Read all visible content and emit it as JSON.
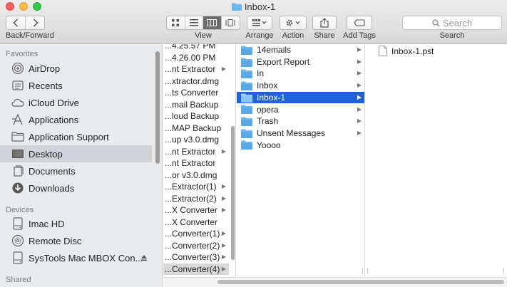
{
  "window": {
    "title": "Inbox-1"
  },
  "toolbar": {
    "nav_label": "Back/Forward",
    "view_label": "View",
    "arrange_label": "Arrange",
    "action_label": "Action",
    "share_label": "Share",
    "tags_label": "Add Tags",
    "search_placeholder": "Search",
    "search_label": "Search"
  },
  "sidebar": {
    "sections": {
      "favorites": "Favorites",
      "devices": "Devices",
      "shared": "Shared"
    },
    "favorites": [
      {
        "label": "AirDrop",
        "icon": "airdrop-icon"
      },
      {
        "label": "Recents",
        "icon": "recents-icon"
      },
      {
        "label": "iCloud Drive",
        "icon": "cloud-icon"
      },
      {
        "label": "Applications",
        "icon": "applications-icon"
      },
      {
        "label": "Application Support",
        "icon": "folder-icon"
      },
      {
        "label": "Desktop",
        "icon": "desktop-icon",
        "selected": true
      },
      {
        "label": "Documents",
        "icon": "documents-icon"
      },
      {
        "label": "Downloads",
        "icon": "downloads-icon"
      }
    ],
    "devices": [
      {
        "label": "Imac HD",
        "icon": "hard-drive-icon"
      },
      {
        "label": "Remote Disc",
        "icon": "disc-icon"
      },
      {
        "label": "SysTools Mac MBOX Con...",
        "icon": "drive-icon"
      }
    ]
  },
  "column1": {
    "items": [
      {
        "label": "...4.25.57 PM",
        "arrow": false
      },
      {
        "label": "...4.26.00 PM",
        "arrow": false
      },
      {
        "label": "...nt Extractor",
        "arrow": true
      },
      {
        "label": "...xtractor.dmg",
        "arrow": false
      },
      {
        "label": "...ts Converter",
        "arrow": false
      },
      {
        "label": "...mail Backup",
        "arrow": false
      },
      {
        "label": "...loud Backup",
        "arrow": false
      },
      {
        "label": "...MAP Backup",
        "arrow": false
      },
      {
        "label": "...up v3.0.dmg",
        "arrow": false
      },
      {
        "label": "...nt Extractor",
        "arrow": true
      },
      {
        "label": "...nt Extractor",
        "arrow": false
      },
      {
        "label": "...or v3.0.dmg",
        "arrow": false
      },
      {
        "label": "...Extractor(1)",
        "arrow": true
      },
      {
        "label": "...Extractor(2)",
        "arrow": true
      },
      {
        "label": "...X Converter",
        "arrow": true
      },
      {
        "label": "...X Converter",
        "arrow": false
      },
      {
        "label": "...Converter(1)",
        "arrow": true
      },
      {
        "label": "...Converter(2)",
        "arrow": true
      },
      {
        "label": "...Converter(3)",
        "arrow": true
      },
      {
        "label": "...Converter(4)",
        "arrow": true
      }
    ]
  },
  "column2": {
    "items": [
      {
        "label": "14emails"
      },
      {
        "label": "Export Report"
      },
      {
        "label": "In"
      },
      {
        "label": "Inbox"
      },
      {
        "label": "Inbox-1",
        "selected": true
      },
      {
        "label": "opera"
      },
      {
        "label": "Trash"
      },
      {
        "label": "Unsent Messages"
      },
      {
        "label": "Yoooo"
      }
    ]
  },
  "column3": {
    "items": [
      {
        "label": "Inbox-1.pst",
        "icon": "document-icon"
      }
    ]
  },
  "colors": {
    "selection_blue": "#1f63d6",
    "folder_blue": "#6cb8f0",
    "sidebar_bg": "#e9ecef"
  }
}
